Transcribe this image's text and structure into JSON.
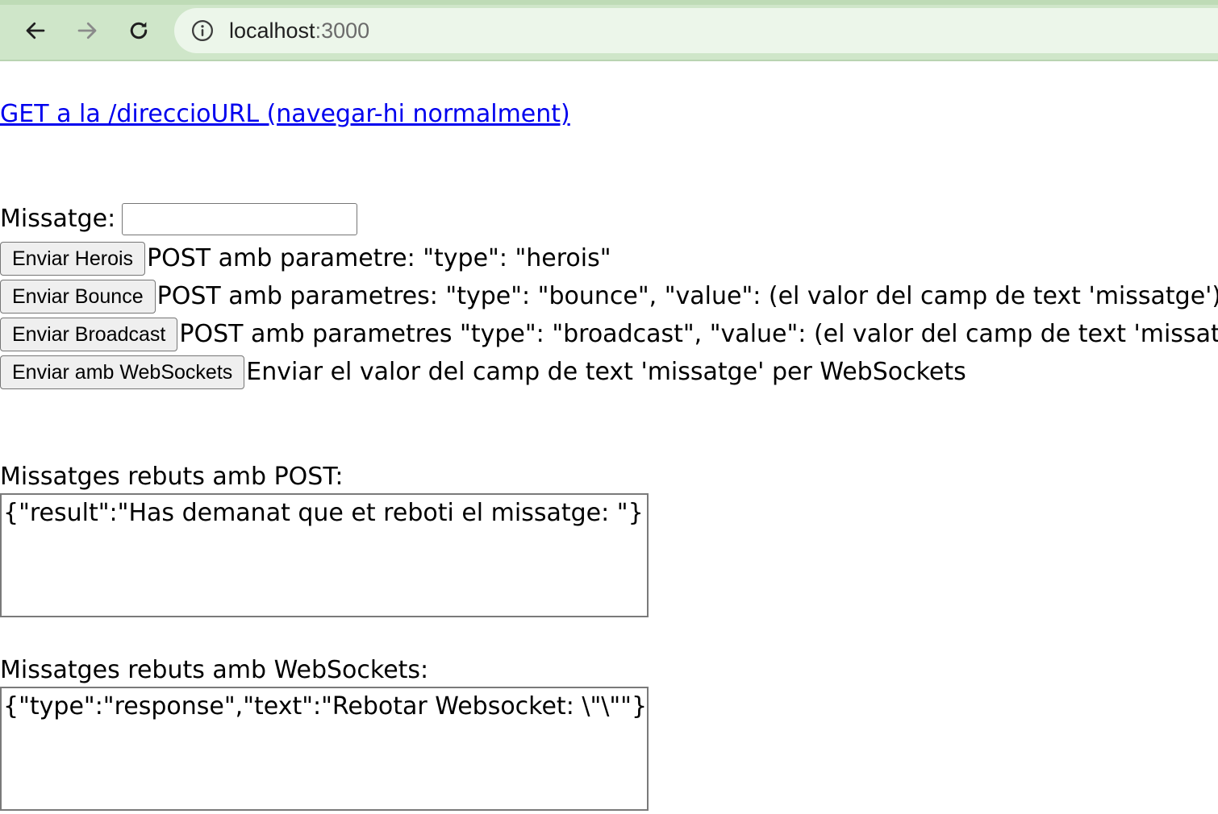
{
  "browser": {
    "url_host": "localhost",
    "url_port": ":3000",
    "icons": [
      "back-arrow-icon",
      "forward-arrow-icon",
      "reload-icon",
      "site-info-icon"
    ]
  },
  "page": {
    "get_link": "GET a la /direccioURL (navegar-hi normalment)",
    "message_label": "Missatge:",
    "message_value": "",
    "actions": [
      {
        "button": "Enviar Herois",
        "description": "POST amb parametre: \"type\": \"herois\""
      },
      {
        "button": "Enviar Bounce",
        "description": "POST amb parametres: \"type\": \"bounce\", \"value\": (el valor del camp de text 'missatge')"
      },
      {
        "button": "Enviar Broadcast",
        "description": "POST amb parametres \"type\": \"broadcast\", \"value\": (el valor del camp de text 'missatge')"
      },
      {
        "button": "Enviar amb WebSockets",
        "description": "Enviar el valor del camp de text 'missatge' per WebSockets"
      }
    ],
    "post_label": "Missatges rebuts amb POST:",
    "post_output": "{\"result\":\"Has demanat que et reboti el missatge: \"}",
    "ws_label": "Missatges rebuts amb WebSockets:",
    "ws_output": "{\"type\":\"response\",\"text\":\"Rebotar Websocket: \\\"\\\"\"}"
  },
  "colors": {
    "browser_bar": "#cfe6c9",
    "address_bar": "#ecf6ea",
    "link": "#0000ee"
  }
}
